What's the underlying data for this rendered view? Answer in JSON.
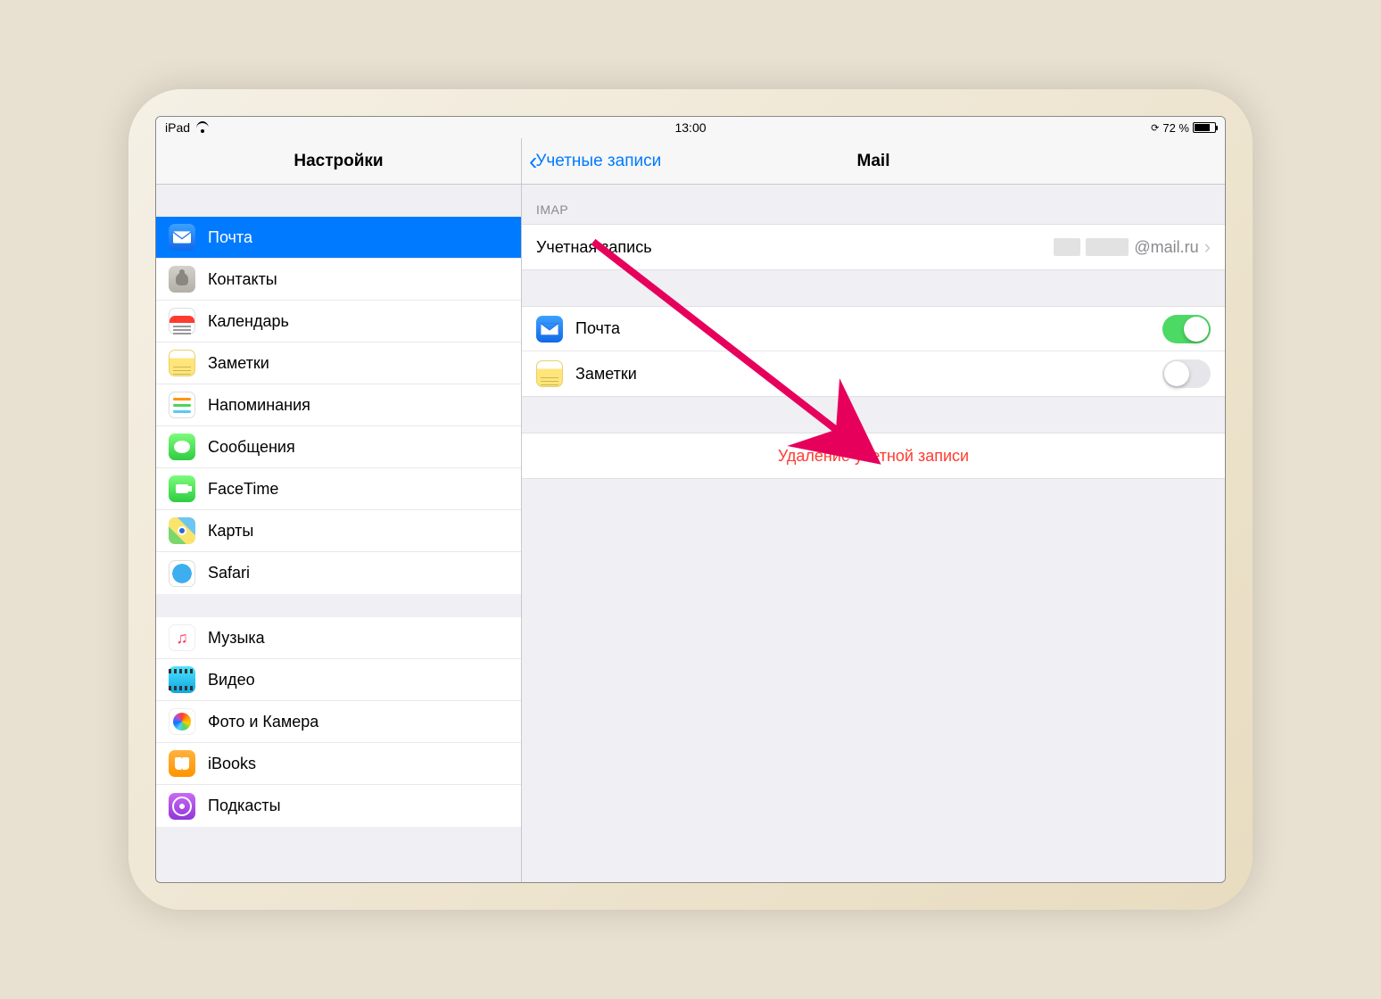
{
  "statusbar": {
    "device": "iPad",
    "time": "13:00",
    "battery_pct": "72 %"
  },
  "left_panel": {
    "title": "Настройки",
    "groups": [
      [
        {
          "id": "mail",
          "label": "Почта",
          "icon": "ic-mail",
          "selected": true
        },
        {
          "id": "contacts",
          "label": "Контакты",
          "icon": "ic-contacts"
        },
        {
          "id": "calendar",
          "label": "Календарь",
          "icon": "ic-calendar"
        },
        {
          "id": "notes",
          "label": "Заметки",
          "icon": "ic-notes"
        },
        {
          "id": "reminders",
          "label": "Напоминания",
          "icon": "ic-reminders"
        },
        {
          "id": "messages",
          "label": "Сообщения",
          "icon": "ic-messages"
        },
        {
          "id": "facetime",
          "label": "FaceTime",
          "icon": "ic-facetime"
        },
        {
          "id": "maps",
          "label": "Карты",
          "icon": "ic-maps"
        },
        {
          "id": "safari",
          "label": "Safari",
          "icon": "ic-safari"
        }
      ],
      [
        {
          "id": "music",
          "label": "Музыка",
          "icon": "ic-music"
        },
        {
          "id": "videos",
          "label": "Видео",
          "icon": "ic-videos"
        },
        {
          "id": "photos",
          "label": "Фото и Камера",
          "icon": "ic-photos"
        },
        {
          "id": "ibooks",
          "label": "iBooks",
          "icon": "ic-ibooks"
        },
        {
          "id": "podcasts",
          "label": "Подкасты",
          "icon": "ic-podcasts"
        }
      ]
    ]
  },
  "right_panel": {
    "back_label": "Учетные записи",
    "title": "Mail",
    "section_imap_header": "IMAP",
    "account_row": {
      "label": "Учетная запись",
      "value_suffix": "@mail.ru"
    },
    "toggles": {
      "mail": {
        "label": "Почта",
        "icon": "ic-mail",
        "on": true
      },
      "notes": {
        "label": "Заметки",
        "icon": "ic-notes",
        "on": false
      }
    },
    "delete_label": "Удаление учетной записи"
  },
  "annotation": {
    "arrow_color": "#e6005c"
  }
}
